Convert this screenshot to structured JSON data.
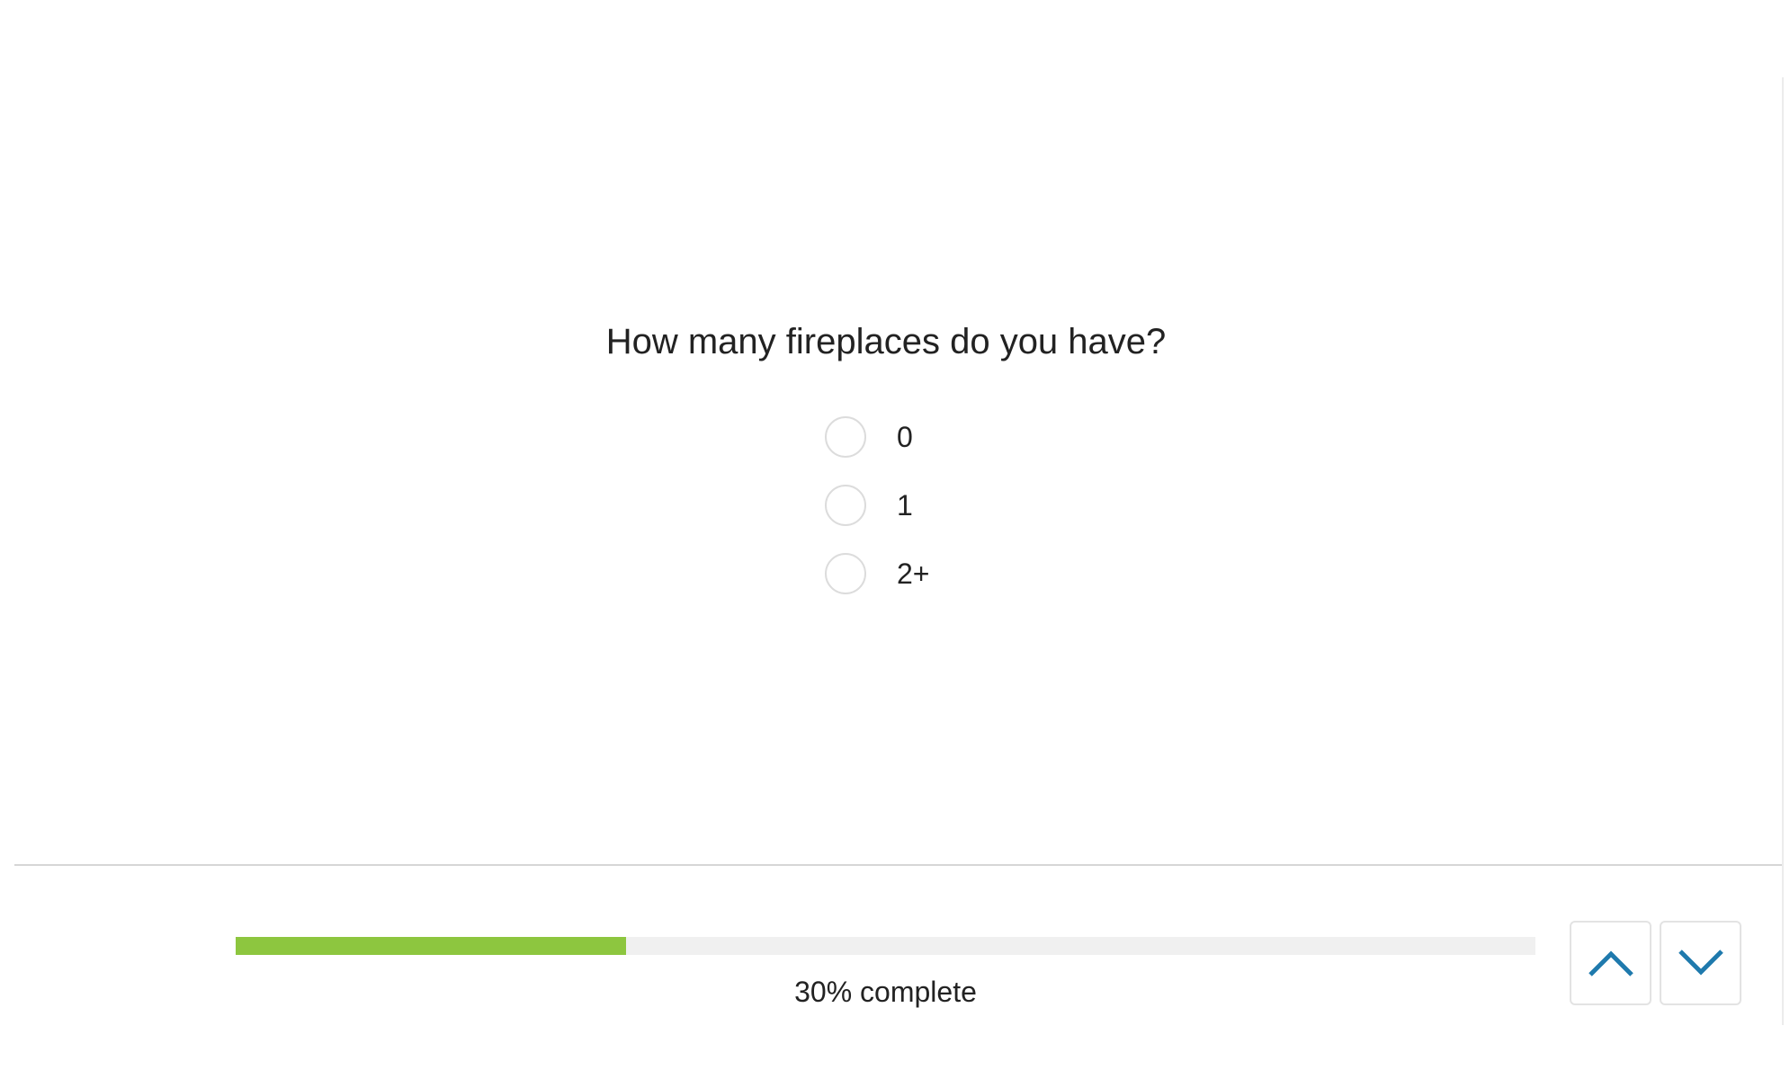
{
  "question": {
    "title": "How many fireplaces do you have?",
    "options": [
      {
        "label": "0",
        "selected": false
      },
      {
        "label": "1",
        "selected": false
      },
      {
        "label": "2+",
        "selected": false
      }
    ]
  },
  "progress": {
    "percent": 30,
    "label": "30% complete",
    "fill_color": "#8dc63f",
    "track_color": "#f0f0f0"
  },
  "navigation": {
    "up_icon": "chevron-up-icon",
    "down_icon": "chevron-down-icon",
    "icon_color": "#1f7aad"
  }
}
